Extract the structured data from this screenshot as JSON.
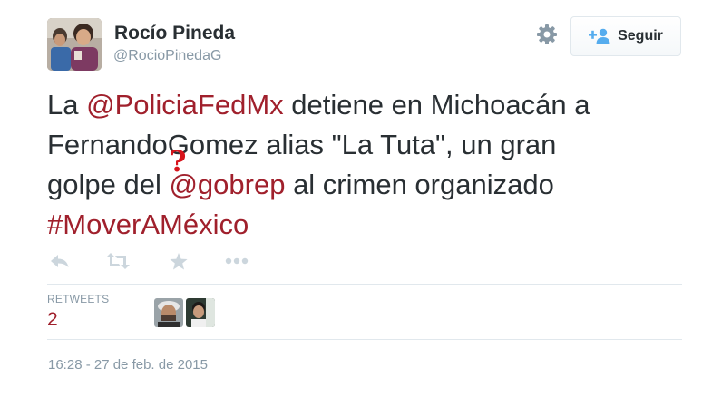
{
  "tweet": {
    "author": {
      "display_name": "Rocío Pineda",
      "screen_name": "@RocioPinedaG",
      "avatar_icon": "profile-photo"
    },
    "follow_button": {
      "label": "Seguir",
      "icon": "add-user-icon"
    },
    "settings_icon": "gear-icon",
    "text": {
      "line1": {
        "pre": "La ",
        "mention": "@PoliciaFedMx",
        "post": " detiene en Michoacán a"
      },
      "line2": {
        "pre": "Fernando",
        "mark": "?",
        "post": "Gomez alias \"La Tuta\", un gran"
      },
      "line3": {
        "pre": "golpe del ",
        "mention": "@gobrep",
        "post": " al crimen organizado"
      },
      "line4": {
        "hashtag": "#MoverAMéxico"
      }
    },
    "actions": {
      "reply_icon": "reply-icon",
      "retweet_icon": "retweet-icon",
      "favorite_icon": "star-icon",
      "more_icon": "more-dots-icon"
    },
    "stats": {
      "retweets_label": "RETWEETS",
      "retweets_count": "2",
      "retweeter_avatars": [
        "retweeter-avatar-1",
        "retweeter-avatar-2"
      ]
    },
    "timestamp": "16:28 - 27 de feb. de 2015",
    "colors": {
      "link": "#a0202c",
      "text": "#292f33",
      "muted": "#8899a6",
      "annotation_mark": "#d7141c",
      "follow_icon": "#55acee"
    }
  }
}
